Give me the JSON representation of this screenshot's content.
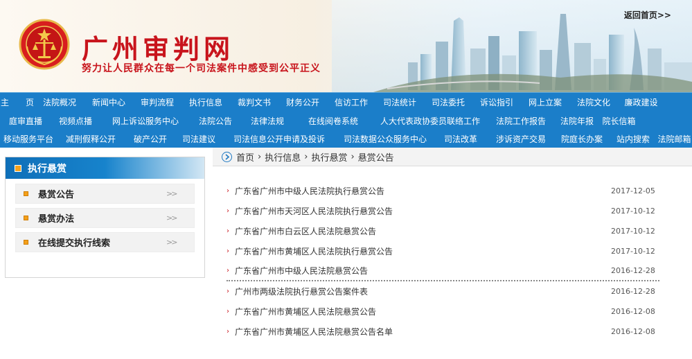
{
  "header": {
    "title": "广州审判网",
    "slogan": "努力让人民群众在每一个司法案件中感受到公平正义",
    "back_home": "返回首页>>"
  },
  "nav": {
    "rows": [
      [
        "主　　页",
        "法院概况",
        "新闻中心",
        "审判流程",
        "执行信息",
        "裁判文书",
        "财务公开",
        "信访工作",
        "司法统计",
        "司法委托",
        "诉讼指引",
        "网上立案",
        "法院文化",
        "廉政建设"
      ],
      [
        "庭审直播",
        "视频点播",
        "网上诉讼服务中心",
        "法院公告",
        "法律法规",
        "在线阅卷系统",
        "人大代表政协委员联络工作",
        "法院工作报告",
        "法院年报",
        "院长信箱"
      ],
      [
        "移动服务平台",
        "减刑假释公开",
        "破产公开",
        "司法建议",
        "司法信息公开申请及投诉",
        "司法数据公众服务中心",
        "司法改革",
        "涉诉资产交易",
        "院庭长办案",
        "站内搜索",
        "法院邮箱"
      ]
    ]
  },
  "sidebar": {
    "title": "执行悬赏",
    "items": [
      {
        "label": "悬赏公告"
      },
      {
        "label": "悬赏办法"
      },
      {
        "label": "在线提交执行线索"
      }
    ],
    "chevron": ">>"
  },
  "breadcrumb": [
    "首页",
    "执行信息",
    "执行悬赏",
    "悬赏公告"
  ],
  "notices": [
    {
      "title": "广东省广州市中级人民法院执行悬赏公告",
      "date": "2017-12-05"
    },
    {
      "title": "广东省广州市天河区人民法院执行悬赏公告",
      "date": "2017-10-12"
    },
    {
      "title": "广东省广州市白云区人民法院悬赏公告",
      "date": "2017-10-12"
    },
    {
      "title": "广东省广州市黄埔区人民法院执行悬赏公告",
      "date": "2017-10-12"
    },
    {
      "title": "广东省广州市中级人民法院悬赏公告",
      "date": "2016-12-28"
    },
    {
      "title": "广州市两级法院执行悬赏公告案件表",
      "date": "2016-12-28"
    },
    {
      "title": "广东省广州市黄埔区人民法院悬赏公告",
      "date": "2016-12-08"
    },
    {
      "title": "广东省广州市黄埔区人民法院悬赏公告名单",
      "date": "2016-12-08"
    }
  ],
  "colors": {
    "brand_red": "#c8141c",
    "nav_blue": "#1b7ec9",
    "accent_orange": "#f3a01b"
  }
}
